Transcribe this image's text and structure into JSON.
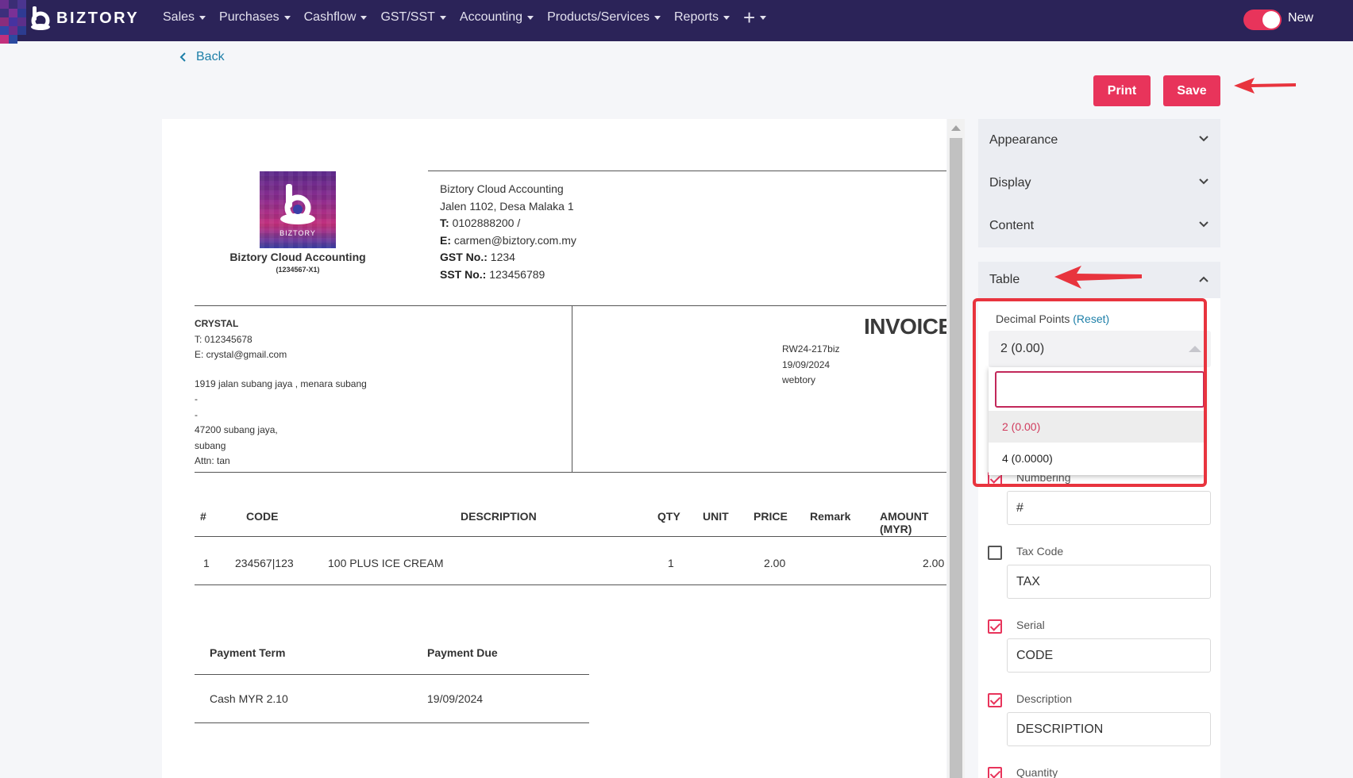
{
  "app": {
    "brand": "BIZTORY",
    "brand_color": "#2b2358",
    "accent_color": "#e8345b",
    "nav": [
      "Sales",
      "Purchases",
      "Cashflow",
      "GST/SST",
      "Accounting",
      "Products/Services",
      "Reports"
    ],
    "nav_add": "+",
    "toggle_label": "New",
    "toggle_on": true
  },
  "actions": {
    "back": "Back",
    "print": "Print",
    "save": "Save"
  },
  "invoice": {
    "logo_text": "BIZTORY",
    "company_name": "Biztory Cloud Accounting",
    "company_reg": "(1234567-X1)",
    "company_block": {
      "name": "Biztory Cloud Accounting",
      "address": "Jalen 1102, Desa Malaka 1",
      "phone_label": "T:",
      "phone": "0102888200 /",
      "email_label": "E:",
      "email": "carmen@biztory.com.my",
      "gst_label": "GST No.:",
      "gst": "1234",
      "sst_label": "SST No.:",
      "sst": "123456789"
    },
    "customer": {
      "name": "CRYSTAL",
      "phone": "T: 012345678",
      "email": "E: crystal@gmail.com",
      "address1": "1919 jalan subang jaya , menara subang",
      "address2": "-",
      "address3": "-",
      "address4": "47200 subang jaya,",
      "address5": "subang",
      "attn": "Attn: tan"
    },
    "title": "INVOICE",
    "number": "RW24-217biz",
    "date": "19/09/2024",
    "reference": "webtory",
    "columns": {
      "num": "#",
      "code": "CODE",
      "description": "DESCRIPTION",
      "qty": "QTY",
      "unit": "UNIT",
      "price": "PRICE",
      "remark": "Remark",
      "amount": "AMOUNT (MYR)"
    },
    "rows": [
      {
        "num": "1",
        "code": "234567|123",
        "description": "100 PLUS ICE CREAM",
        "qty": "1",
        "unit": "",
        "price": "2.00",
        "remark": "",
        "amount": "2.00"
      }
    ],
    "payment": {
      "term_header": "Payment Term",
      "due_header": "Payment Due",
      "term": "Cash MYR 2.10",
      "due": "19/09/2024"
    }
  },
  "settings": {
    "sections": [
      "Appearance",
      "Display",
      "Content"
    ],
    "table_section": "Table",
    "decimal_label": "Decimal Points",
    "decimal_reset": "(Reset)",
    "decimal_selected": "2 (0.00)",
    "decimal_search": "",
    "decimal_options": [
      "2 (0.00)",
      "4 (0.0000)"
    ],
    "numbering_label": "Numbering",
    "numbering_value": "#",
    "numbering_checked": true,
    "tax_code_label": "Tax Code",
    "tax_code_value": "TAX",
    "tax_code_checked": false,
    "serial_label": "Serial",
    "serial_value": "CODE",
    "serial_checked": true,
    "description_label": "Description",
    "description_value": "DESCRIPTION",
    "description_checked": true,
    "quantity_label": "Quantity",
    "quantity_checked": true
  }
}
